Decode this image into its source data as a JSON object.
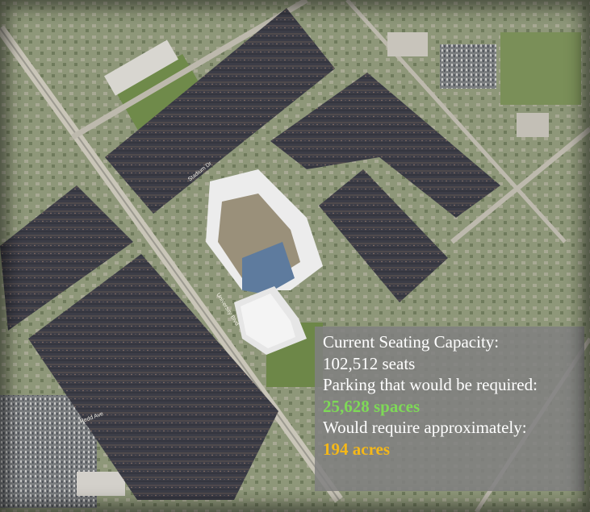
{
  "caption": {
    "capacity_label": "Current Seating Capacity:",
    "capacity_value": "102,512 seats",
    "parking_label": "Parking that would be required:",
    "parking_value": "25,628 spaces",
    "area_label": "Would require approximately:",
    "area_value": "194 acres"
  },
  "colors": {
    "parking_value": "#7ed957",
    "area_value": "#f5b818",
    "parking_lot": "#3c3d47",
    "map_ground": "#8f9a78"
  },
  "map_labels": {
    "road_north": "Stadium Dr",
    "road_west": "Redd Ave",
    "road_central": "University Blvd"
  }
}
